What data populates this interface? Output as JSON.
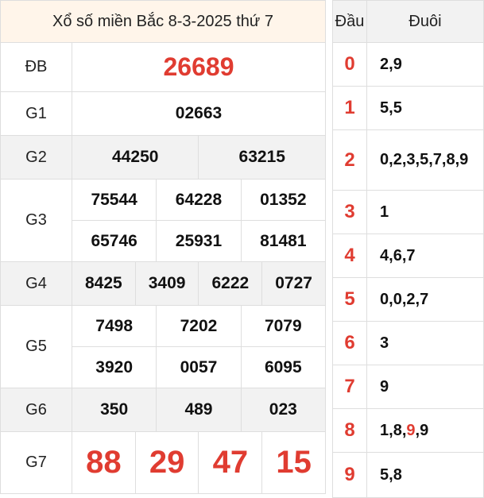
{
  "title": "Xổ số miền Bắc 8-3-2025 thứ 7",
  "prizes": {
    "db": {
      "label": "ĐB",
      "numbers": [
        "26689"
      ]
    },
    "g1": {
      "label": "G1",
      "numbers": [
        "02663"
      ]
    },
    "g2": {
      "label": "G2",
      "numbers": [
        "44250",
        "63215"
      ]
    },
    "g3": {
      "label": "G3",
      "numbers": [
        "75544",
        "64228",
        "01352",
        "65746",
        "25931",
        "81481"
      ]
    },
    "g4": {
      "label": "G4",
      "numbers": [
        "8425",
        "3409",
        "6222",
        "0727"
      ]
    },
    "g5": {
      "label": "G5",
      "numbers": [
        "7498",
        "7202",
        "7079",
        "3920",
        "0057",
        "6095"
      ]
    },
    "g6": {
      "label": "G6",
      "numbers": [
        "350",
        "489",
        "023"
      ]
    },
    "g7": {
      "label": "G7",
      "numbers": [
        "88",
        "29",
        "47",
        "15"
      ]
    }
  },
  "loto": {
    "head_label": "Đầu",
    "tail_label": "Đuôi",
    "rows": [
      {
        "head": "0",
        "tails": [
          "2",
          "9"
        ]
      },
      {
        "head": "1",
        "tails": [
          "5",
          "5"
        ]
      },
      {
        "head": "2",
        "tails": [
          "0",
          "2",
          "3",
          "5",
          "7",
          "8",
          "9"
        ]
      },
      {
        "head": "3",
        "tails": [
          "1"
        ]
      },
      {
        "head": "4",
        "tails": [
          "4",
          "6",
          "7"
        ]
      },
      {
        "head": "5",
        "tails": [
          "0",
          "0",
          "2",
          "7"
        ]
      },
      {
        "head": "6",
        "tails": [
          "3"
        ]
      },
      {
        "head": "7",
        "tails": [
          "9"
        ]
      },
      {
        "head": "8",
        "tails": [
          "1",
          "8",
          "9",
          "9"
        ],
        "highlight_index": 2
      },
      {
        "head": "9",
        "tails": [
          "5",
          "8"
        ]
      }
    ]
  },
  "colors": {
    "accent_red": "#e03c31",
    "title_bg": "#fff5ea",
    "row_gray": "#f2f2f2"
  }
}
